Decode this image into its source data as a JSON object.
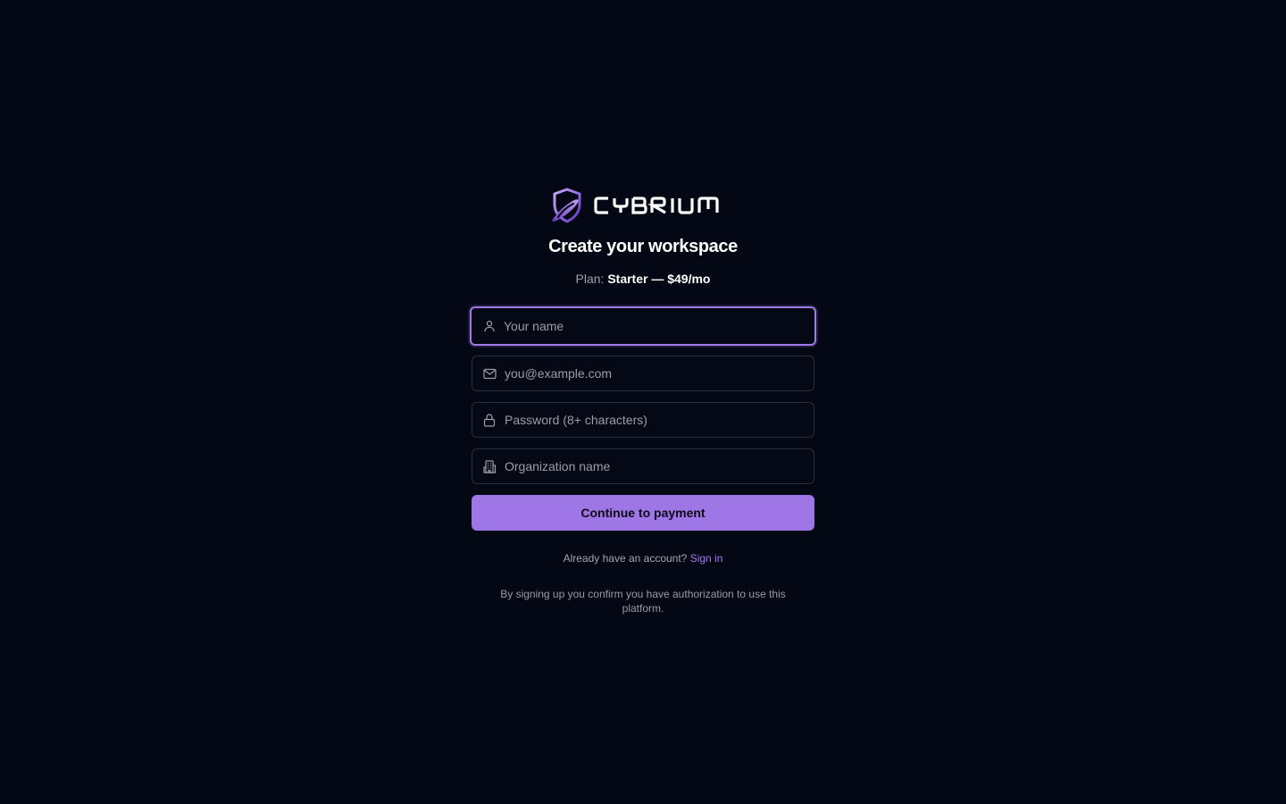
{
  "brand": {
    "name": "CYBRIUM",
    "accent_color": "#9e76e6"
  },
  "header": {
    "title": "Create your workspace",
    "plan_label": "Plan:",
    "plan_value": "Starter — $49/mo"
  },
  "form": {
    "name": {
      "placeholder": "Your name",
      "value": "",
      "icon": "user-icon",
      "focused": true
    },
    "email": {
      "placeholder": "you@example.com",
      "value": "",
      "icon": "mail-icon"
    },
    "password": {
      "placeholder": "Password (8+ characters)",
      "value": "",
      "icon": "lock-icon"
    },
    "organization": {
      "placeholder": "Organization name",
      "value": "",
      "icon": "building-icon"
    },
    "submit_label": "Continue to payment"
  },
  "footer": {
    "account_prompt": "Already have an account?",
    "signin_link": "Sign in",
    "legal": "By signing up you confirm you have authorization to use this platform."
  }
}
